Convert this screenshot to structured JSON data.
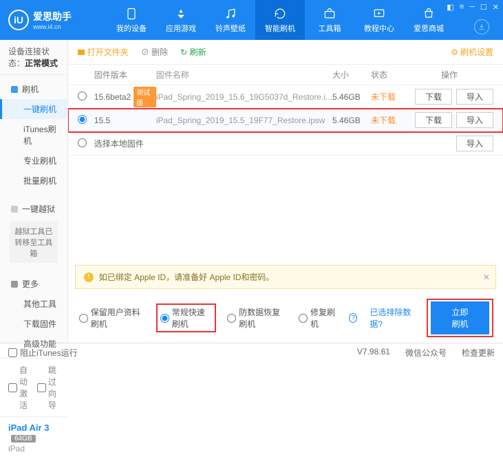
{
  "app": {
    "name": "爱思助手",
    "url": "www.i4.cn",
    "logo_letter": "iU"
  },
  "nav": [
    {
      "label": "我的设备"
    },
    {
      "label": "应用游戏"
    },
    {
      "label": "铃声壁纸"
    },
    {
      "label": "智能刷机"
    },
    {
      "label": "工具箱"
    },
    {
      "label": "教程中心"
    },
    {
      "label": "爱思商城"
    }
  ],
  "conn": {
    "label": "设备连接状态：",
    "value": "正常模式"
  },
  "sidebar": {
    "flash": {
      "head": "刷机",
      "items": [
        "一键刷机",
        "iTunes刷机",
        "专业刷机",
        "批量刷机"
      ]
    },
    "jb": {
      "head": "一键越狱",
      "note": "越狱工具已转移至工具箱"
    },
    "more": {
      "head": "更多",
      "items": [
        "其他工具",
        "下载固件",
        "高级功能"
      ]
    },
    "auto_activate": "自动激活",
    "skip_guide": "跳过向导"
  },
  "device": {
    "name": "iPad Air 3",
    "storage": "64GB",
    "type": "iPad"
  },
  "toolbar": {
    "open": "打开文件夹",
    "delete": "删除",
    "refresh": "刷新",
    "settings": "刷机设置"
  },
  "columns": {
    "ver": "固件版本",
    "name": "固件名称",
    "size": "大小",
    "status": "状态",
    "ops": "操作"
  },
  "rows": [
    {
      "ver": "15.6beta2",
      "badge": "测试版",
      "name": "iPad_Spring_2019_15.6_19G5037d_Restore.i...",
      "size": "5.46GB",
      "status": "未下载",
      "selected": false
    },
    {
      "ver": "15.5",
      "badge": "",
      "name": "iPad_Spring_2019_15.5_19F77_Restore.ipsw",
      "size": "5.46GB",
      "status": "未下载",
      "selected": true
    }
  ],
  "local_fw": "选择本地固件",
  "btn": {
    "download": "下载",
    "import": "导入"
  },
  "warning": "如已绑定 Apple ID，请准备好 Apple ID和密码。",
  "modes": [
    "保留用户资料刷机",
    "常规快速刷机",
    "防数据恢复刷机",
    "修复刷机"
  ],
  "exclude_link": "已选排除数据?",
  "flash_btn": "立即刷机",
  "footer": {
    "block_itunes": "阻止iTunes运行",
    "version": "V7.98.61",
    "wechat": "微信公众号",
    "update": "检查更新"
  }
}
